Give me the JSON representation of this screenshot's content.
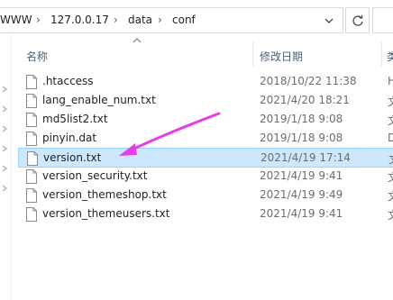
{
  "breadcrumb": [
    "WWW",
    "127.0.0.17",
    "data",
    "conf"
  ],
  "columns": {
    "name": "名称",
    "modified": "修改日期",
    "type_partial": "类"
  },
  "files": [
    {
      "name": ".htaccess",
      "modified": "2018/10/22 11:38",
      "type_partial": "H"
    },
    {
      "name": "lang_enable_num.txt",
      "modified": "2021/4/20 18:21",
      "type_partial": "文"
    },
    {
      "name": "md5list2.txt",
      "modified": "2019/1/18 9:08",
      "type_partial": "文"
    },
    {
      "name": "pinyin.dat",
      "modified": "2019/1/18 9:08",
      "type_partial": "D"
    },
    {
      "name": "version.txt",
      "modified": "2021/4/19 17:14",
      "type_partial": "文",
      "selected": true
    },
    {
      "name": "version_security.txt",
      "modified": "2021/4/19 9:41",
      "type_partial": "文"
    },
    {
      "name": "version_themeshop.txt",
      "modified": "2021/4/19 9:49",
      "type_partial": "文"
    },
    {
      "name": "version_themeusers.txt",
      "modified": "2021/4/19 9:41",
      "type_partial": "文"
    }
  ],
  "colors": {
    "selection": "#cce8ff",
    "annotation_arrow": "#e83ce8"
  },
  "icons": {
    "refresh": "refresh-icon",
    "dropdown": "chevron-down-icon",
    "file": "document-icon"
  }
}
